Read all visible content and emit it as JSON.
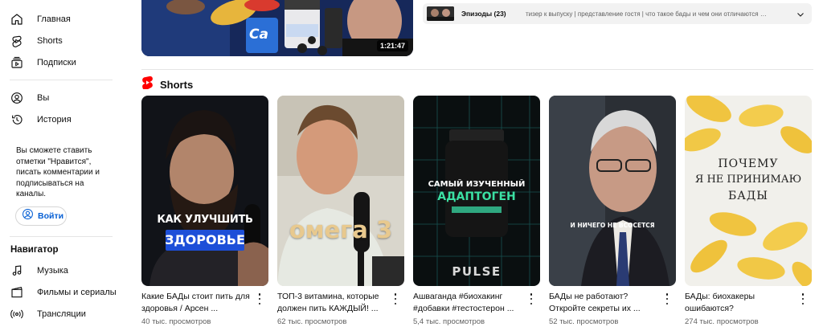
{
  "sidebar": {
    "items": [
      {
        "label": "Главная",
        "icon": "home-icon"
      },
      {
        "label": "Shorts",
        "icon": "shorts-icon"
      },
      {
        "label": "Подписки",
        "icon": "subscriptions-icon"
      },
      {
        "label": "Вы",
        "icon": "you-icon"
      },
      {
        "label": "История",
        "icon": "history-icon"
      }
    ],
    "signin_prompt": "Вы сможете ставить отметки \"Нравится\", писать комментарии и подписываться на каналы.",
    "signin_button": "Войти",
    "navigator_title": "Навигатор",
    "navigator_items": [
      {
        "label": "Музыка",
        "icon": "music-icon"
      },
      {
        "label": "Фильмы и сериалы",
        "icon": "movies-icon"
      },
      {
        "label": "Трансляции",
        "icon": "live-icon"
      }
    ]
  },
  "top_video": {
    "duration": "1:21:47",
    "thumb_text_ca": "Ca"
  },
  "episodes": {
    "title": "Эпизоды (23)",
    "description": "тизер к выпуску | представление гостя | что такое бады и чем они отличаются от лекарст..."
  },
  "shorts": {
    "heading": "Shorts",
    "items": [
      {
        "title": "Какие БАДы стоит пить для здоровья / Арсен ...",
        "views": "40 тыс. просмотров",
        "overlay_1": "КАК УЛУЧШИТЬ",
        "overlay_2": "ЗДОРОВЬЕ"
      },
      {
        "title": "ТОП-3 витамина, которые должен пить КАЖДЫЙ! ...",
        "views": "62 тыс. просмотров",
        "overlay_1": "омега 3"
      },
      {
        "title": "Ашваганда #биохакинг #добавки #тестостерон ...",
        "views": "5,4 тыс. просмотров",
        "overlay_1": "САМЫЙ ИЗУЧЕННЫЙ",
        "overlay_2": "АДАПТОГЕН",
        "overlay_3": "PULSE"
      },
      {
        "title": "БАДы не работают? Откройте секреты их ...",
        "views": "52 тыс. просмотров",
        "overlay_1": "И НИЧЕГО НЕ ВСОСЕТСЯ"
      },
      {
        "title": "БАДы: биохакеры ошибаются?",
        "views": "274 тыс. просмотров",
        "overlay_1": "ПОЧЕМУ",
        "overlay_2": "Я НЕ ПРИНИМАЮ",
        "overlay_3": "БАДЫ"
      }
    ]
  },
  "colors": {
    "accent_red": "#ff0000",
    "link_blue": "#065fd4",
    "secondary_text": "#606060"
  }
}
